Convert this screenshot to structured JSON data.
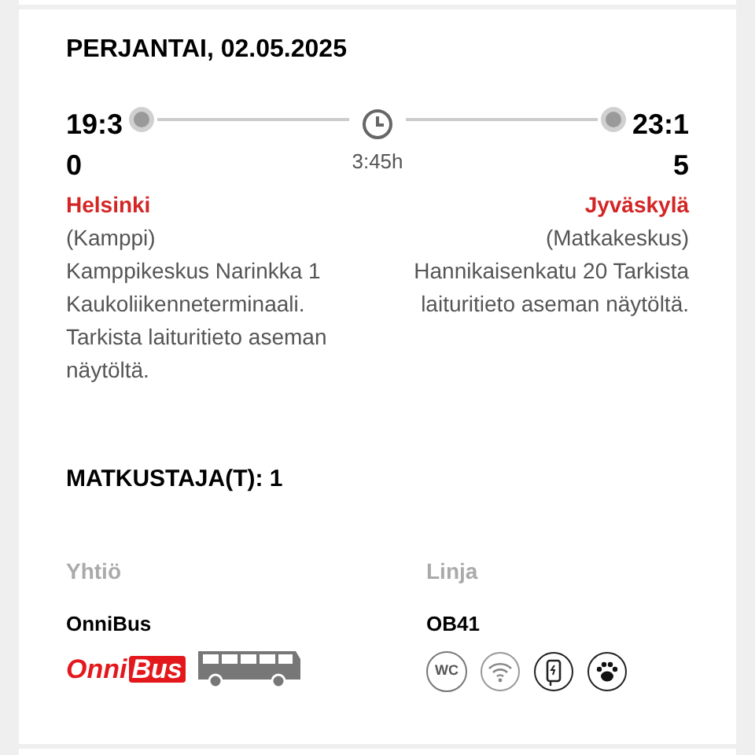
{
  "date": "PERJANTAI, 02.05.2025",
  "departure": {
    "time": "19:30",
    "city": "Helsinki",
    "station": "(Kamppi)",
    "details": "Kamppikeskus Narinkka 1 Kaukoliikenneterminaali. Tarkista laituritieto aseman näytöltä."
  },
  "duration": "3:45h",
  "arrival": {
    "time": "23:15",
    "city": "Jyväskylä",
    "station": "(Matkakeskus)",
    "details": "Hannikaisenkatu 20 Tarkista laituritieto aseman näytöltä."
  },
  "passengers": "MATKUSTAJA(T): 1",
  "operator": {
    "label": "Yhtiö",
    "name": "OnniBus",
    "logo": [
      "Onni",
      "Bus"
    ]
  },
  "line": {
    "label": "Linja",
    "code": "OB41"
  },
  "amenities": [
    {
      "kind": "wc",
      "text": "WC"
    },
    {
      "kind": "wifi"
    },
    {
      "kind": "charging"
    },
    {
      "kind": "pets"
    }
  ]
}
